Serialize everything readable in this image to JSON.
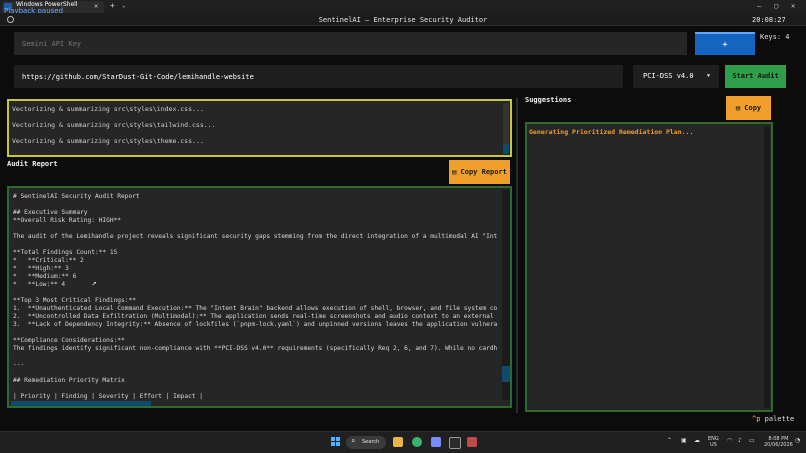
{
  "window": {
    "tab_title": "Windows PowerShell",
    "overlay": "Playback paused",
    "tab_close": "✕",
    "new_tab": "+",
    "tab_dropdown": "⌄",
    "minimize": "—",
    "maximize": "▢",
    "close": "✕"
  },
  "app": {
    "title": "SentinelAI — Enterprise Security Auditor",
    "clock": "20:08:27"
  },
  "api": {
    "placeholder": "Gemini API Key",
    "add_label": "+",
    "keys_label": "Keys: 4"
  },
  "repo": {
    "url": "https://github.com/StarDust-Git-Code/lemihandle-website"
  },
  "standard": {
    "selected": "PCI-DSS v4.0",
    "caret": "▼"
  },
  "start_audit_label": "Start Audit",
  "log": {
    "lines": [
      "Vectorizing & summarizing src\\styles\\index.css...",
      "Vectorizing & summarizing src\\styles\\tailwind.css...",
      "Vectorizing & summarizing src\\styles\\theme.css..."
    ]
  },
  "audit": {
    "label": "Audit Report",
    "copy_label": "Copy Report",
    "lines": [
      "# SentinelAI Security Audit Report",
      "",
      "## Executive Summary",
      "**Overall Risk Rating: HIGH**",
      "",
      "The audit of the Lemihandle project reveals significant security gaps stemming from the direct integration of a multimodal AI \"Int",
      "",
      "**Total Findings Count:** 15",
      "*   **Critical:** 2",
      "*   **High:** 3",
      "*   **Medium:** 6",
      "*   **Low:** 4",
      "",
      "**Top 3 Most Critical Findings:**",
      "1.  **Unauthenticated Local Command Execution:** The \"Intent Brain\" backend allows execution of shell, browser, and file system co",
      "2.  **Uncontrolled Data Exfiltration (Multimodal):** The application sends real-time screenshots and audio context to an external",
      "3.  **Lack of Dependency Integrity:** Absence of lockfiles (`pnpm-lock.yaml`) and unpinned versions leaves the application vulnera",
      "",
      "**Compliance Considerations:**",
      "The findings identify significant non-compliance with **PCI-DSS v4.0** requirements (specifically Req 2, 6, and 7). While no cardh",
      "",
      "---",
      "",
      "## Remediation Priority Matrix",
      "",
      "| Priority | Finding | Severity | Effort | Impact |"
    ]
  },
  "suggestions": {
    "label": "Suggestions",
    "copy_label": "Copy",
    "status": "Generating Prioritized Remediation Plan..."
  },
  "footer": {
    "palette_key": "^p",
    "palette_label": " palette"
  },
  "taskbar": {
    "search": "Search",
    "lang_1": "ENG",
    "lang_2": "US",
    "time": "8:08 PM",
    "date": "20/06/2026"
  },
  "colors": {
    "accent_blue": "#1565c0",
    "start_green": "#2e9e4a",
    "copy_orange": "#f0a02a",
    "log_border": "#c8c63a",
    "panel_border": "#2d6a2d"
  }
}
